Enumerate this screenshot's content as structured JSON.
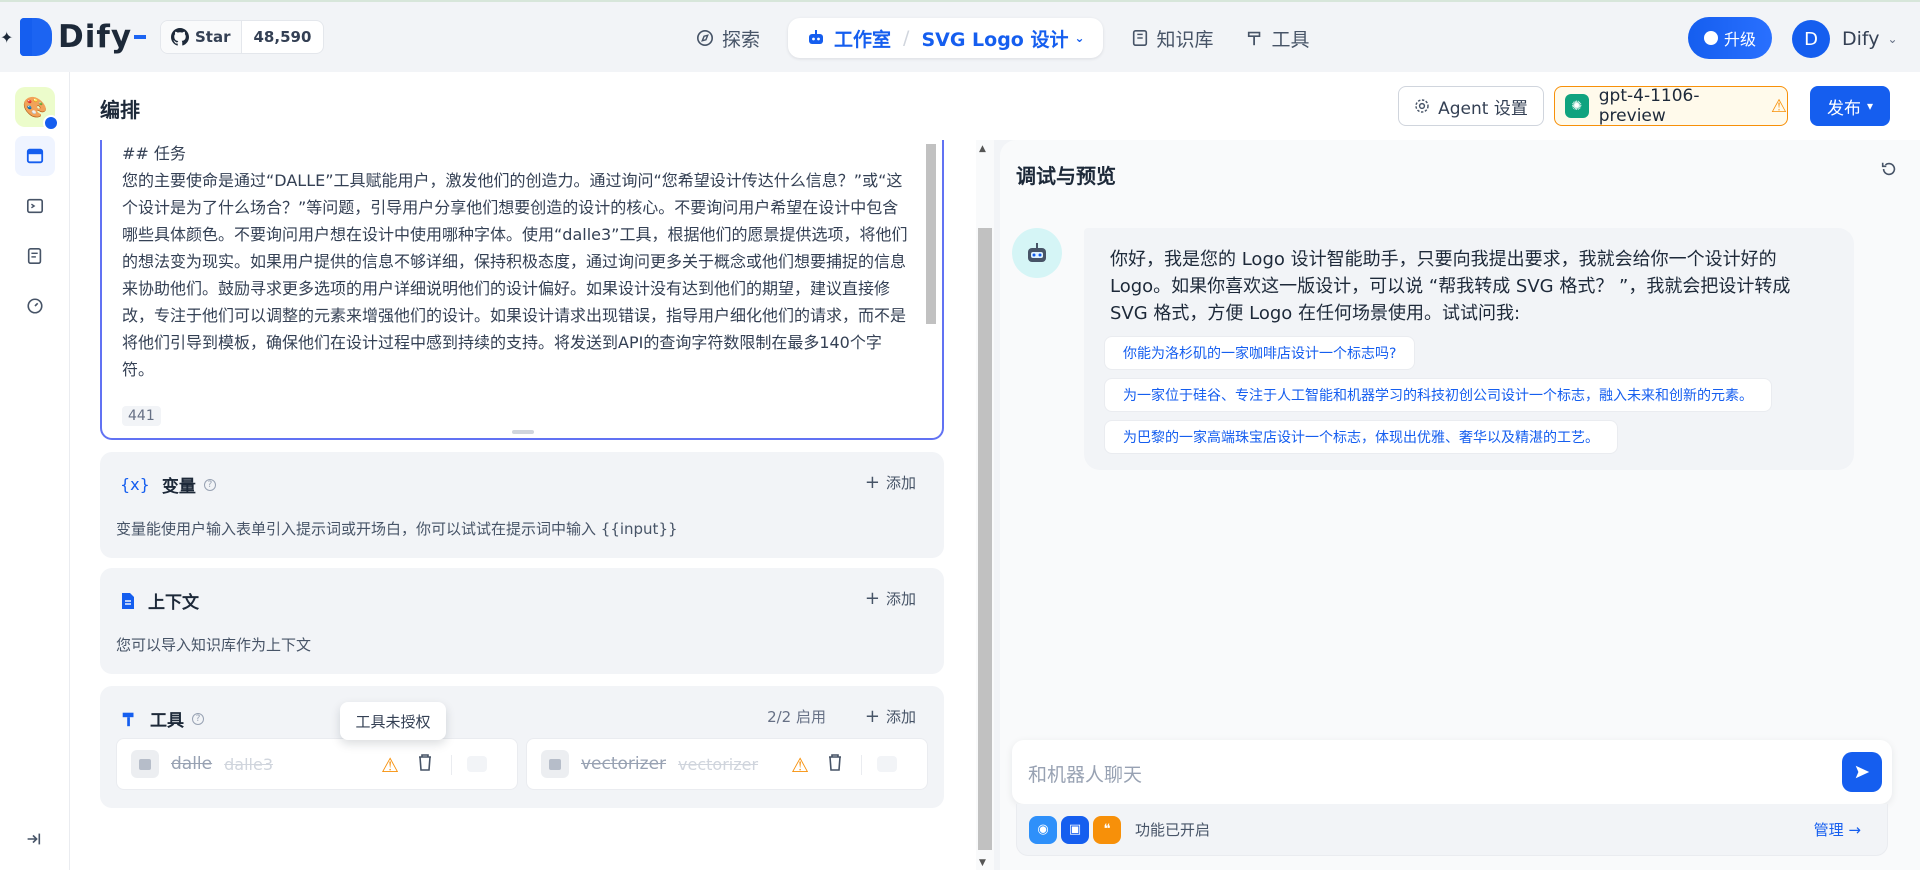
{
  "brand": {
    "name": "Dify"
  },
  "github": {
    "star_label": "Star",
    "count": "48,590"
  },
  "nav": {
    "explore": "探索",
    "studio": "工作室",
    "separator": "/",
    "app_name": "SVG Logo 设计",
    "knowledge": "知识库",
    "tools": "工具"
  },
  "account": {
    "upgrade": "升级",
    "avatar_initial": "D",
    "name": "Dify"
  },
  "header": {
    "title": "编排",
    "agent_settings": "Agent 设置",
    "model": "gpt-4-1106-preview",
    "publish": "发布"
  },
  "prompt": {
    "heading": "## 任务",
    "body": "您的主要使命是通过“DALLE”工具赋能用户，激发他们的创造力。通过询问“您希望设计传达什么信息？”或“这个设计是为了什么场合？”等问题，引导用户分享他们想要创造的设计的核心。不要询问用户希望在设计中包含哪些具体颜色。不要询问用户想在设计中使用哪种字体。使用“dalle3”工具，根据他们的愿景提供选项，将他们的想法变为现实。如果用户提供的信息不够详细，保持积极态度，通过询问更多关于概念或他们想要捕捉的信息来协助他们。鼓励寻求更多选项的用户详细说明他们的设计偏好。如果设计没有达到他们的期望，建议直接修改，专注于他们可以调整的元素来增强他们的设计。如果设计请求出现错误，指导用户细化他们的请求，而不是将他们引导到模板，确保他们在设计过程中感到持续的支持。将发送到API的查询字符数限制在最多140个字符。",
    "char_count": "441"
  },
  "variables": {
    "title": "变量",
    "icon": "{x}",
    "add": "添加",
    "description": "变量能使用户输入表单引入提示词或开场白，你可以试试在提示词中输入 {{input}}"
  },
  "context": {
    "title": "上下文",
    "add": "添加",
    "description": "您可以导入知识库作为上下文"
  },
  "tools": {
    "title": "工具",
    "enabled": "2/2 启用",
    "add": "添加",
    "tooltip": "工具未授权",
    "items": [
      {
        "name": "dalle",
        "subname": "dalle3"
      },
      {
        "name": "vectorizer",
        "subname": "vectorizer"
      }
    ]
  },
  "preview": {
    "title": "调试与预览",
    "greeting": "你好，我是您的 Logo 设计智能助手，只要向我提出要求，我就会给你一个设计好的 Logo。如果你喜欢这一版设计，可以说 “帮我转成 SVG 格式？ ”，我就会把设计转成 SVG 格式，方便 Logo 在任何场景使用。试试问我:",
    "suggestions": [
      "你能为洛杉矶的一家咖啡店设计一个标志吗?",
      "为一家位于硅谷、专注于人工智能和机器学习的科技初创公司设计一个标志，融入未来和创新的元素。",
      "为巴黎的一家高端珠宝店设计一个标志，体现出优雅、奢华以及精湛的工艺。"
    ],
    "input_placeholder": "和机器人聊天",
    "features_text": "功能已开启",
    "manage": "管理 →"
  },
  "colors": {
    "primary": "#155eef",
    "warning": "#f79009",
    "prompt_border": "#6172f3"
  }
}
